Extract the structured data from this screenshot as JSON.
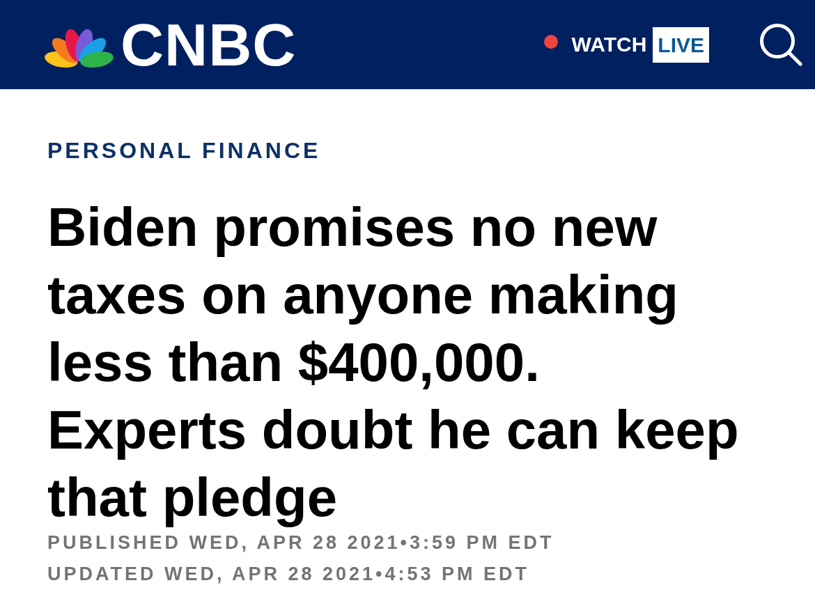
{
  "header": {
    "logo_text": "CNBC",
    "watch_label": "WATCH",
    "live_badge": "LIVE"
  },
  "article": {
    "section": "PERSONAL FINANCE",
    "headline": "Biden promises no new taxes on anyone making less than $400,000. Experts doubt he can keep that pledge",
    "published": "PUBLISHED WED, APR 28 2021•3:59 PM EDT",
    "updated": "UPDATED WED, APR 28 2021•4:53 PM EDT"
  }
}
